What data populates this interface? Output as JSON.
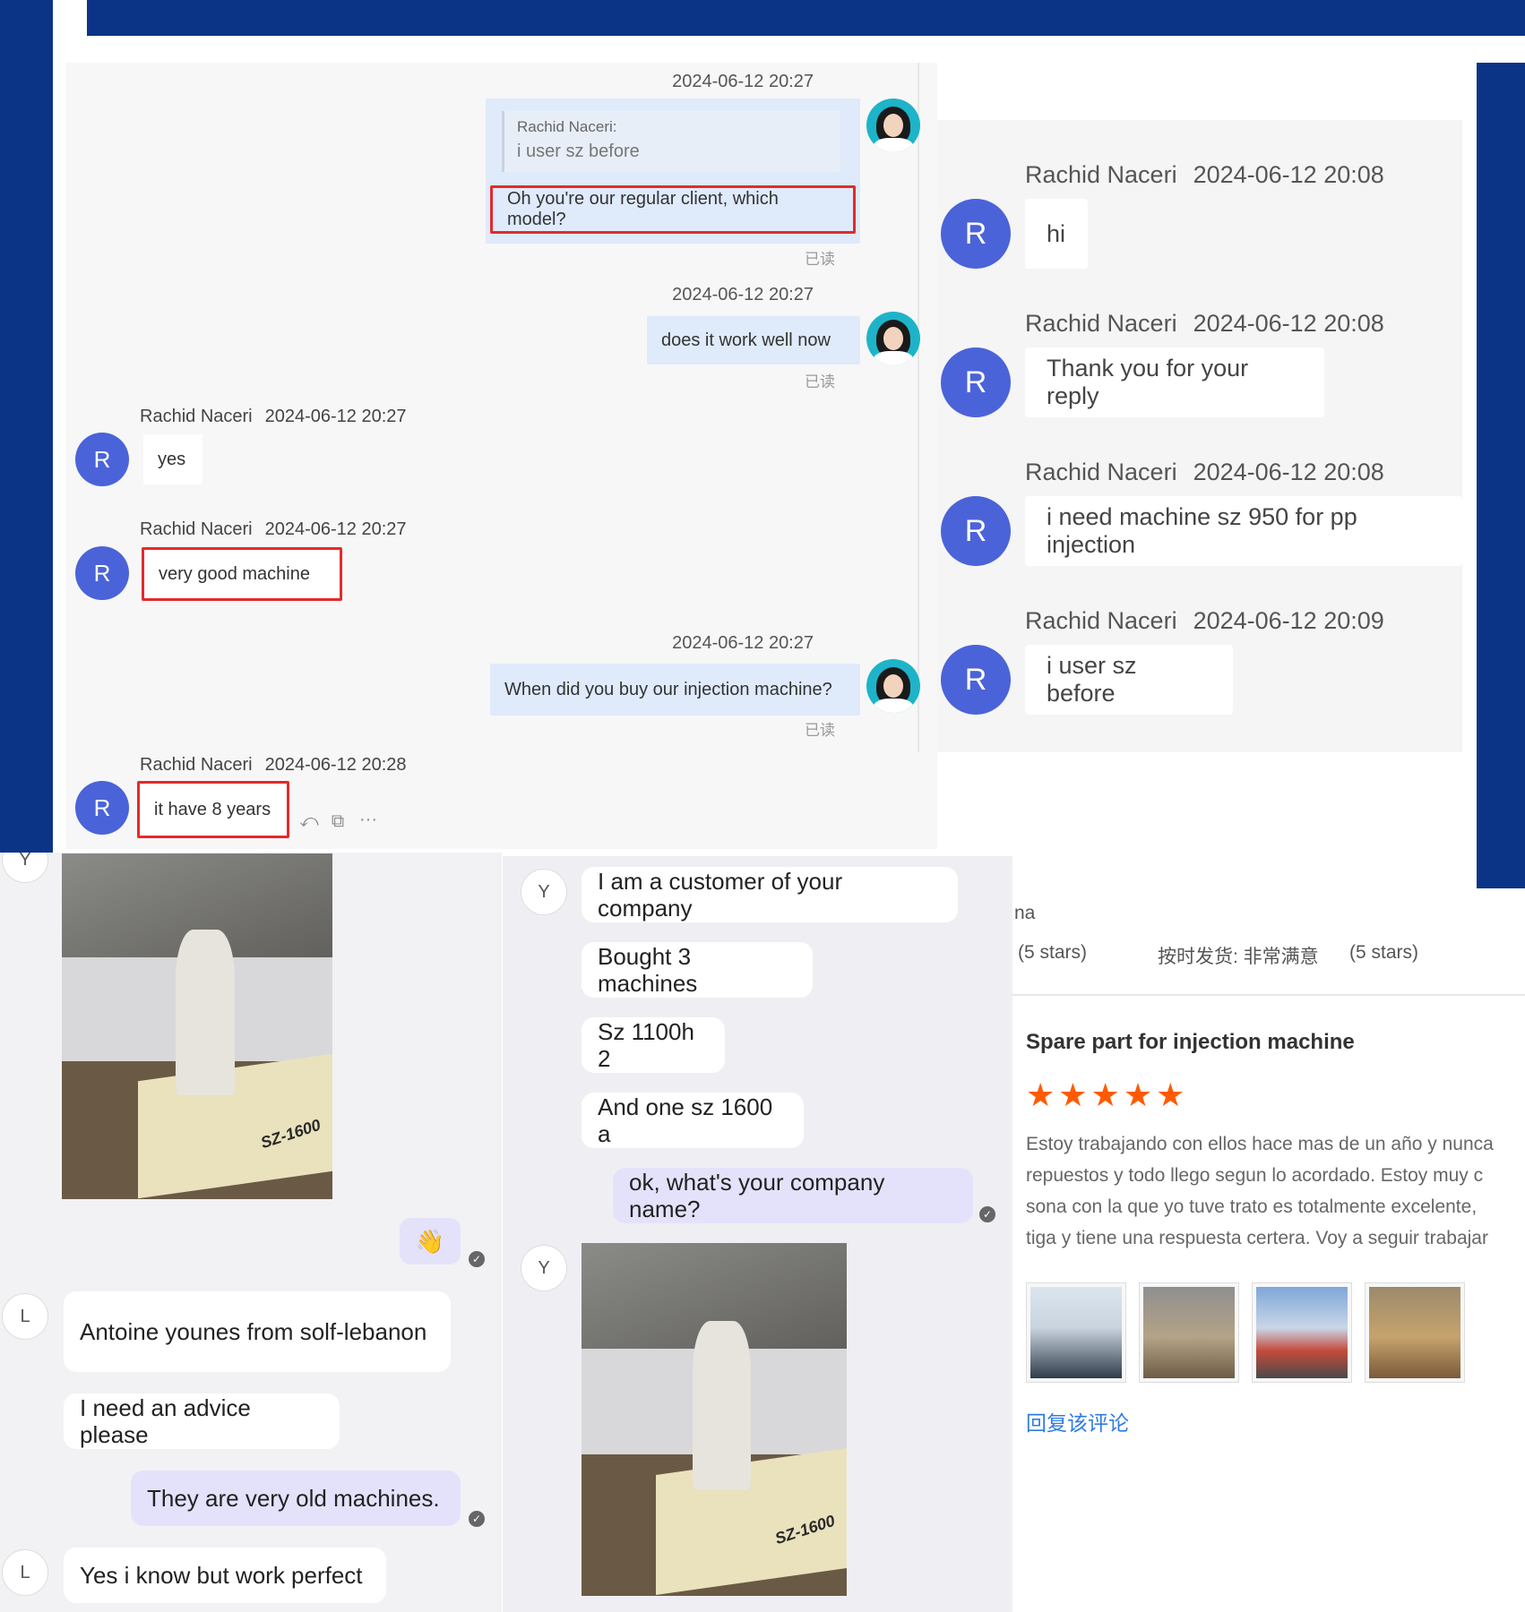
{
  "colors": {
    "navy": "#0b3487",
    "red_highlight": "#e22b2b",
    "avatar_blue": "#4b63d8",
    "star": "#ff5a00",
    "link": "#2f7be5"
  },
  "panel_a": {
    "msg1": {
      "timestamp": "2024-06-12 20:27",
      "quote_name": "Rachid Naceri:",
      "quote_text": "i user sz before",
      "text": "Oh you're our regular client, which model?",
      "read": "已读"
    },
    "msg2": {
      "timestamp": "2024-06-12 20:27",
      "text": "does it work well now",
      "read": "已读"
    },
    "msg3": {
      "sender": "Rachid Naceri",
      "timestamp": "2024-06-12 20:27",
      "text": "yes",
      "avatar": "R"
    },
    "msg4": {
      "sender": "Rachid Naceri",
      "timestamp": "2024-06-12 20:27",
      "text": "very good machine",
      "avatar": "R"
    },
    "msg5": {
      "timestamp": "2024-06-12 20:27",
      "text": "When did you buy our injection machine?",
      "read": "已读"
    },
    "msg6": {
      "sender": "Rachid Naceri",
      "timestamp": "2024-06-12 20:28",
      "text": "it have 8 years",
      "avatar": "R"
    },
    "tools": {
      "reply_icon": "⤺",
      "translate_icon": "⧉",
      "more_icon": "···"
    }
  },
  "panel_b": {
    "messages": [
      {
        "sender": "Rachid Naceri",
        "timestamp": "2024-06-12 20:08",
        "text": "hi",
        "avatar": "R"
      },
      {
        "sender": "Rachid Naceri",
        "timestamp": "2024-06-12 20:08",
        "text": "Thank you for your reply",
        "avatar": "R"
      },
      {
        "sender": "Rachid Naceri",
        "timestamp": "2024-06-12 20:08",
        "text": "i need machine sz 950 for pp injection",
        "avatar": "R"
      },
      {
        "sender": "Rachid Naceri",
        "timestamp": "2024-06-12 20:09",
        "text": "i user sz before",
        "avatar": "R"
      }
    ]
  },
  "panel_c": {
    "top_avatar": "Y",
    "photo_label": "SZ-1600",
    "emoji": "👋",
    "msg1_avatar": "L",
    "msg1_text": "Antoine younes from solf-lebanon",
    "msg2_text": "I need an advice please",
    "msg3_text": "They are very  old machines.",
    "msg4_avatar": "L",
    "msg4_text": "Yes i know but work perfect"
  },
  "panel_d": {
    "avatar": "Y",
    "messages": [
      "I am a customer of your company",
      "Bought 3 machines",
      "Sz 1100h 2",
      "And one sz 1600 a"
    ],
    "reply": "ok, what's your company name?",
    "photo_avatar": "Y",
    "photo_label": "SZ-1600"
  },
  "panel_e": {
    "cut_label": "na",
    "rating1": "(5 stars)",
    "rating2_label": "按时发货: 非常满意",
    "rating2": "(5 stars)",
    "title": "Spare part for injection machine",
    "stars": "★★★★★",
    "text_lines": [
      "Estoy trabajando con ellos hace mas de un año y nunca",
      "repuestos y todo llego segun lo acordado. Estoy muy c",
      "sona con la que yo tuve trato es totalmente excelente,",
      "tiga y tiene una respuesta certera. Voy a seguir trabajar"
    ],
    "reply_link": "回复该评论"
  }
}
